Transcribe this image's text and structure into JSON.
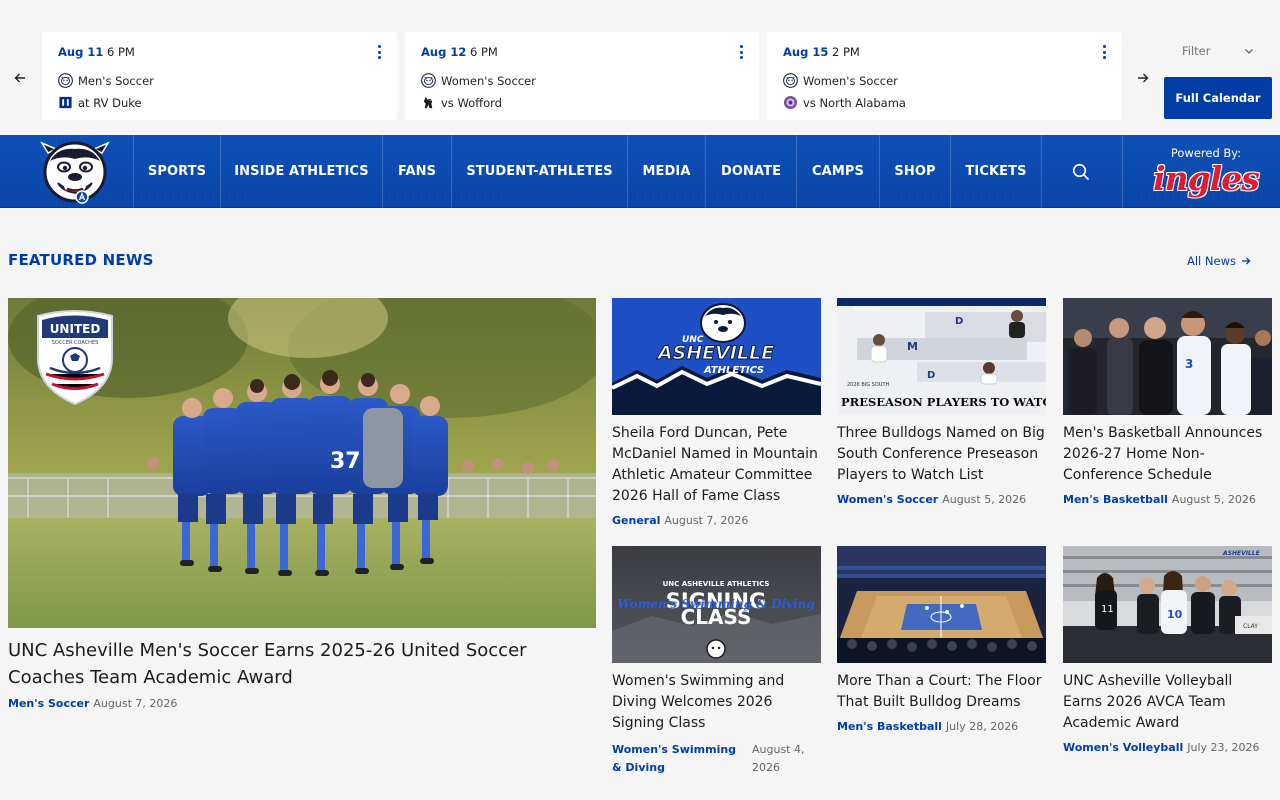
{
  "schedule": {
    "games": [
      {
        "date": "Aug 11",
        "time": "6 PM",
        "sport": "Men's Soccer",
        "opponent": "at RV Duke"
      },
      {
        "date": "Aug 12",
        "time": "6 PM",
        "sport": "Women's Soccer",
        "opponent": "vs Wofford"
      },
      {
        "date": "Aug 15",
        "time": "2 PM",
        "sport": "Women's Soccer",
        "opponent": "vs North Alabama"
      }
    ],
    "filter_label": "Filter",
    "full_calendar_label": "Full Calendar"
  },
  "nav": {
    "items": [
      "SPORTS",
      "INSIDE ATHLETICS",
      "FANS",
      "STUDENT-ATHLETES",
      "MEDIA",
      "DONATE",
      "CAMPS",
      "SHOP",
      "TICKETS"
    ],
    "powered_by": "Powered By:",
    "sponsor": "ingles"
  },
  "featured": {
    "title": "FEATURED NEWS",
    "all_news": "All News",
    "hero": {
      "title": "UNC Asheville Men's Soccer Earns 2025-26 United Soccer Coaches Team Academic Award",
      "category": "Men's Soccer",
      "date": "August 7, 2026",
      "badge_text": "UNITED",
      "badge_sub": "SOCCER COACHES"
    },
    "cards": [
      {
        "title": "Sheila Ford Duncan, Pete McDaniel Named in Mountain Athletic Amateur Committee 2026 Hall of Fame Class",
        "category": "General",
        "date": "August 7, 2026",
        "img_line1": "UNC",
        "img_line2": "ASHEVILLE",
        "img_line3": "ATHLETICS"
      },
      {
        "title": "Three Bulldogs Named on Big South Conference Preseason Players to Watch List",
        "category": "Women's Soccer",
        "date": "August 5, 2026",
        "img_line1": "PRESEASON PLAYERS TO WATCH",
        "img_line2": "2026 BIG SOUTH"
      },
      {
        "title": "Men's Basketball Announces 2026-27 Home Non-Conference Schedule",
        "category": "Men's Basketball",
        "date": "August 5, 2026"
      },
      {
        "title": "Women's Swimming and Diving Welcomes 2026 Signing Class",
        "category": "Women's Swimming & Diving",
        "date": "August 4, 2026",
        "img_line1": "UNC ASHEVILLE ATHLETICS",
        "img_line2": "SIGNING",
        "img_line3": "CLASS",
        "img_script": "Women's Swimming & Diving"
      },
      {
        "title": "More Than a Court: The Floor That Built Bulldog Dreams",
        "category": "Men's Basketball",
        "date": "July 28, 2026"
      },
      {
        "title": "UNC Asheville Volleyball Earns 2026 AVCA Team Academic Award",
        "category": "Women's Volleyball",
        "date": "July 23, 2026"
      }
    ]
  }
}
